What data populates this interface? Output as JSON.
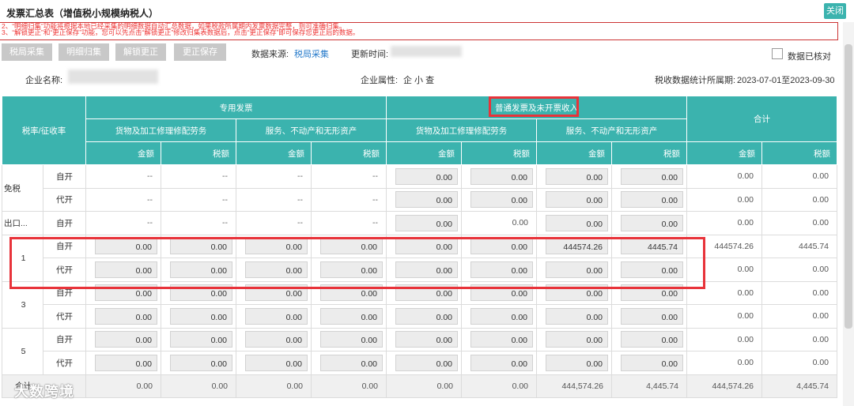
{
  "window": {
    "title": "发票汇总表（增值税小规模纳税人）",
    "close_label": "关闭"
  },
  "notice": {
    "lines": [
      "2、“明细归集”功能将根据本地已经采集的明细数据自动汇总数据，如果税款所属期内发票数据完整，则可准确归集。",
      "3、“解锁更正”和“更正保存”功能，您可以先点击“解锁更正”修改归集表数据后，点击“更正保存”即可保存您更正后的数据。"
    ]
  },
  "toolbar": {
    "btn_collect": "税局采集",
    "btn_detail": "明细归集",
    "btn_unlock": "解锁更正",
    "btn_save": "更正保存",
    "source_label": "数据来源:",
    "source_value": "税局采集",
    "update_label": "更新时间:",
    "verified_label": "数据已核对"
  },
  "info": {
    "company_label": "企业名称:",
    "attr_label": "企业属性:",
    "attr_value": "企 小 查",
    "period_label": "税收数据统计所属期:",
    "period_value": "2023-07-01至2023-09-30"
  },
  "table": {
    "h_rate": "税率/征收率",
    "h_special": "专用发票",
    "h_normal": "普通发票及未开票收入",
    "h_total": "合计",
    "h_goods": "货物及加工修理修配劳务",
    "h_service": "服务、不动产和无形资产",
    "h_amount": "金额",
    "h_tax": "税额",
    "rows": [
      {
        "rate": "免税",
        "sub": "自开",
        "special": [
          "--",
          "--",
          "--",
          "--"
        ],
        "normal": [
          "0.00",
          "0.00",
          "0.00",
          "0.00"
        ],
        "total": [
          "0.00",
          "0.00"
        ]
      },
      {
        "rate": "",
        "sub": "代开",
        "special": [
          "--",
          "--",
          "--",
          "--"
        ],
        "normal": [
          "0.00",
          "0.00",
          "0.00",
          "0.00"
        ],
        "total": [
          "0.00",
          "0.00"
        ]
      },
      {
        "rate": "出口...",
        "sub": "自开",
        "special": [
          "--",
          "--",
          "--",
          "--"
        ],
        "normal": [
          "0.00",
          "0.00",
          "0.00",
          "0.00"
        ],
        "total": [
          "0.00",
          "0.00"
        ]
      },
      {
        "rate": "1",
        "sub": "自开",
        "special": [
          "0.00",
          "0.00",
          "0.00",
          "0.00"
        ],
        "normal": [
          "0.00",
          "0.00",
          "444574.26",
          "4445.74"
        ],
        "total": [
          "444574.26",
          "4445.74"
        ]
      },
      {
        "rate": "",
        "sub": "代开",
        "special": [
          "0.00",
          "0.00",
          "0.00",
          "0.00"
        ],
        "normal": [
          "0.00",
          "0.00",
          "0.00",
          "0.00"
        ],
        "total": [
          "0.00",
          "0.00"
        ]
      },
      {
        "rate": "3",
        "sub": "自开",
        "special": [
          "0.00",
          "0.00",
          "0.00",
          "0.00"
        ],
        "normal": [
          "0.00",
          "0.00",
          "0.00",
          "0.00"
        ],
        "total": [
          "0.00",
          "0.00"
        ]
      },
      {
        "rate": "",
        "sub": "代开",
        "special": [
          "0.00",
          "0.00",
          "0.00",
          "0.00"
        ],
        "normal": [
          "0.00",
          "0.00",
          "0.00",
          "0.00"
        ],
        "total": [
          "0.00",
          "0.00"
        ]
      },
      {
        "rate": "5",
        "sub": "自开",
        "special": [
          "0.00",
          "0.00",
          "0.00",
          "0.00"
        ],
        "normal": [
          "0.00",
          "0.00",
          "0.00",
          "0.00"
        ],
        "total": [
          "0.00",
          "0.00"
        ]
      },
      {
        "rate": "",
        "sub": "代开",
        "special": [
          "0.00",
          "0.00",
          "0.00",
          "0.00"
        ],
        "normal": [
          "0.00",
          "0.00",
          "0.00",
          "0.00"
        ],
        "total": [
          "0.00",
          "0.00"
        ]
      }
    ],
    "total_row": {
      "label": "合计",
      "values": [
        "0.00",
        "0.00",
        "0.00",
        "0.00",
        "0.00",
        "0.00",
        "444,574.26",
        "4,445.74",
        "444,574.26",
        "4,445.74"
      ]
    }
  },
  "watermark": "大数跨境"
}
